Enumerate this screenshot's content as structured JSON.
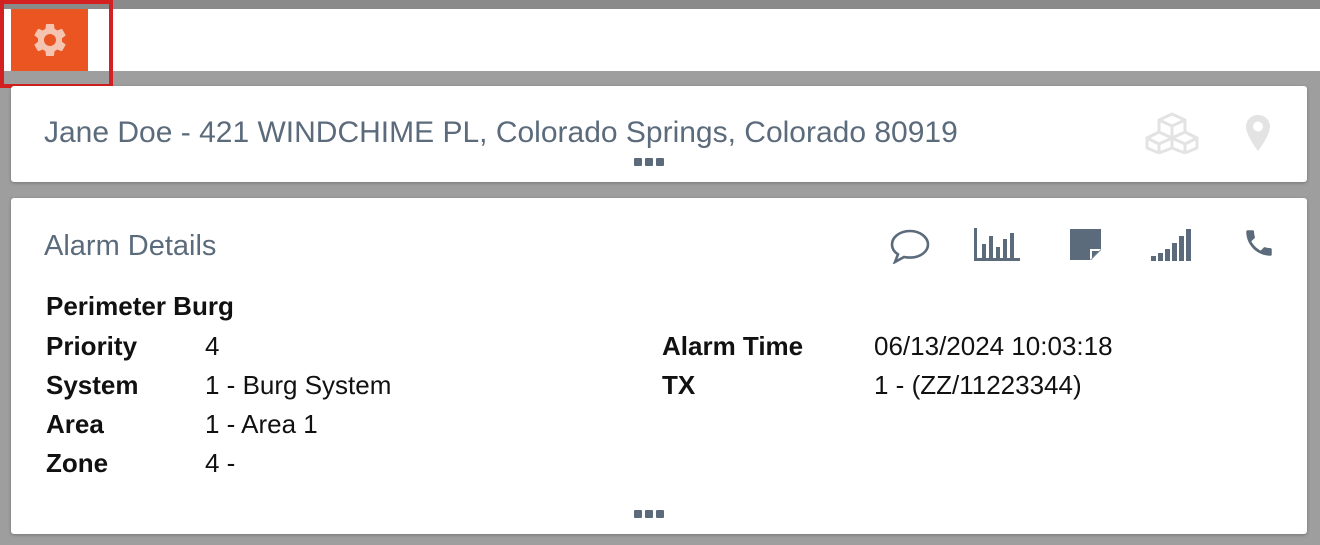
{
  "toolbar": {
    "settings_icon": "gear-icon"
  },
  "customer": {
    "title": "Jane Doe - 421 WINDCHIME PL, Colorado Springs, Colorado 80919",
    "icons": [
      "cubes-icon",
      "map-pin-icon"
    ]
  },
  "alarm": {
    "section_title": "Alarm Details",
    "icons": [
      "comment-icon",
      "bar-chart-icon",
      "note-icon",
      "signal-icon",
      "phone-icon"
    ],
    "event": "Perimeter Burg",
    "left": [
      {
        "label": "Priority",
        "value": "4"
      },
      {
        "label": "System",
        "value": "1 - Burg System"
      },
      {
        "label": "Area",
        "value": "1 - Area 1"
      },
      {
        "label": "Zone",
        "value": "4 -"
      }
    ],
    "right": [
      {
        "label": "Alarm Time",
        "value": "06/13/2024 10:03:18"
      },
      {
        "label": "TX",
        "value": "1 - (ZZ/11223344)"
      }
    ]
  },
  "colors": {
    "accent": "#ea5521",
    "highlight": "#d32020",
    "text_muted": "#5b6b7b"
  }
}
